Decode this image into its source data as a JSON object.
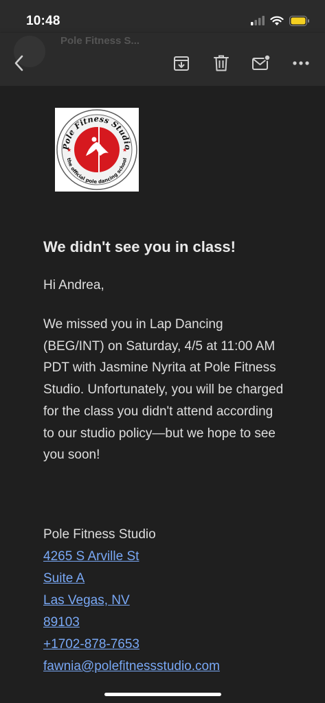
{
  "status_bar": {
    "time": "10:48"
  },
  "toolbar": {
    "sender_preview": "Pole Fitness S...",
    "back_icon": "chevron-left-icon",
    "archive_icon": "archive-icon",
    "delete_icon": "trash-icon",
    "mark_unread_icon": "mail-unread-icon",
    "more_icon": "more-horizontal-icon"
  },
  "email": {
    "logo": {
      "top_text": "Pole Fitness Studio",
      "bottom_text": "the official pole dancing school"
    },
    "heading": "We didn't see you in class!",
    "greeting": "Hi Andrea,",
    "body": "We missed you in Lap Dancing (BEG/INT) on Saturday, 4/5 at 11:00 AM PDT with Jasmine Nyrita at Pole Fitness Studio. Unfortunately, you will be charged for the class you didn't attend according to our studio policy—but we hope to see you soon!",
    "signature": {
      "name": "Pole Fitness Studio",
      "address_line1": "4265 S Arville St",
      "address_line2": "Suite A",
      "city_state": "Las Vegas, NV",
      "zip": "89103",
      "phone": "+1702-878-7653",
      "email": "fawnia@polefitnessstudio.com"
    }
  },
  "colors": {
    "background": "#1f1f1f",
    "toolbar": "#2b2b2b",
    "link": "#79a8f5",
    "battery": "#f4cf20",
    "logo_red": "#d6191f"
  }
}
